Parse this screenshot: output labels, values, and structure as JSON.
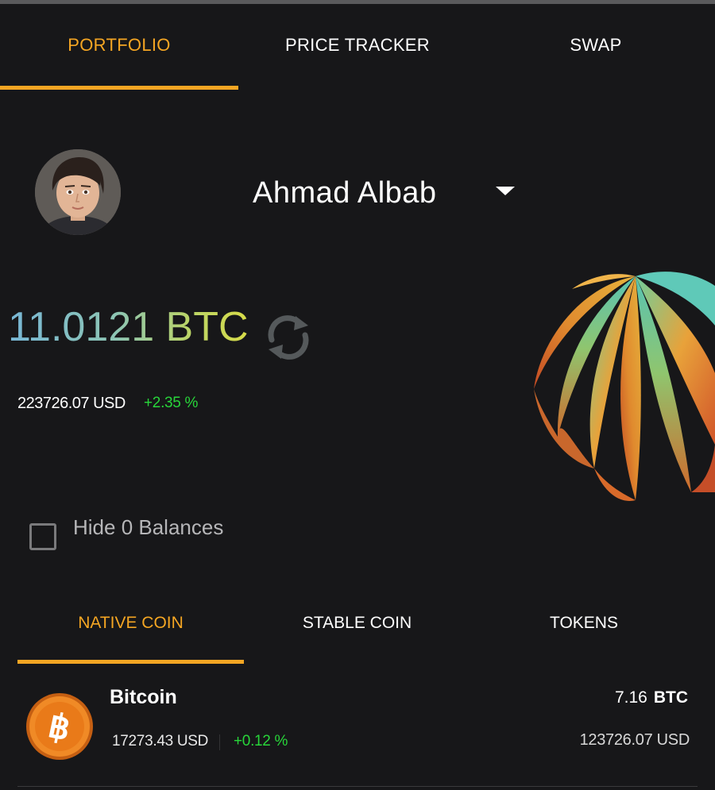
{
  "tabs": [
    {
      "label": "PORTFOLIO",
      "active": true
    },
    {
      "label": "PRICE TRACKER",
      "active": false
    },
    {
      "label": "SWAP",
      "active": false
    }
  ],
  "profile": {
    "name": "Ahmad Albab",
    "avatar_icon": "user-avatar"
  },
  "balance": {
    "amount": "11.0121 BTC",
    "usd": "223726.07 USD",
    "change": "+2.35 %"
  },
  "options": {
    "hide_zero_label": "Hide 0 Balances",
    "hide_zero_checked": false
  },
  "sub_tabs": [
    {
      "label": "NATIVE COIN",
      "active": true
    },
    {
      "label": "STABLE COIN",
      "active": false
    },
    {
      "label": "TOKENS",
      "active": false
    }
  ],
  "coins": [
    {
      "name": "Bitcoin",
      "icon": "bitcoin-icon",
      "price": "17273.43 USD",
      "change": "+0.12 %",
      "amount": "7.16",
      "unit": "BTC",
      "value": "123726.07 USD"
    }
  ],
  "colors": {
    "background": "#171719",
    "accent": "#f5a623",
    "positive": "#28d63a"
  }
}
